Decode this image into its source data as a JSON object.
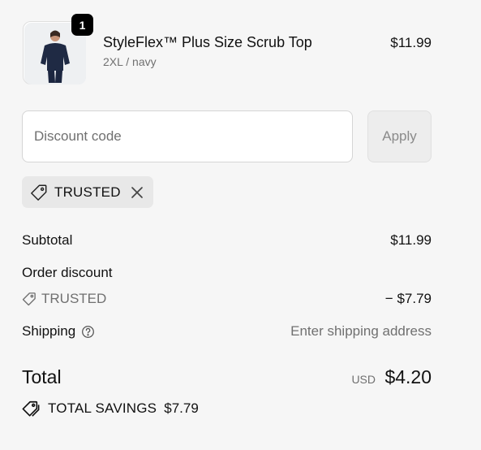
{
  "product": {
    "name": "StyleFlex™ Plus Size Scrub Top",
    "variant": "2XL / navy",
    "price": "$11.99",
    "quantity": "1"
  },
  "discount": {
    "placeholder": "Discount code",
    "apply_label": "Apply",
    "applied_code": "TRUSTED"
  },
  "summary": {
    "subtotal_label": "Subtotal",
    "subtotal_value": "$11.99",
    "order_discount_label": "Order discount",
    "discount_code": "TRUSTED",
    "discount_value": "− $7.79",
    "shipping_label": "Shipping",
    "shipping_value": "Enter shipping address",
    "total_label": "Total",
    "currency": "USD",
    "total_value": "$4.20",
    "savings_label": "TOTAL SAVINGS",
    "savings_value": "$7.79"
  },
  "icons": {
    "tag": "tag-icon",
    "close": "close-icon",
    "help": "help-icon",
    "tags": "tags-icon"
  },
  "colors": {
    "background": "#f6f6f6",
    "muted_text": "#707070",
    "chip_background": "#e8e8e8",
    "badge": "#000000"
  }
}
